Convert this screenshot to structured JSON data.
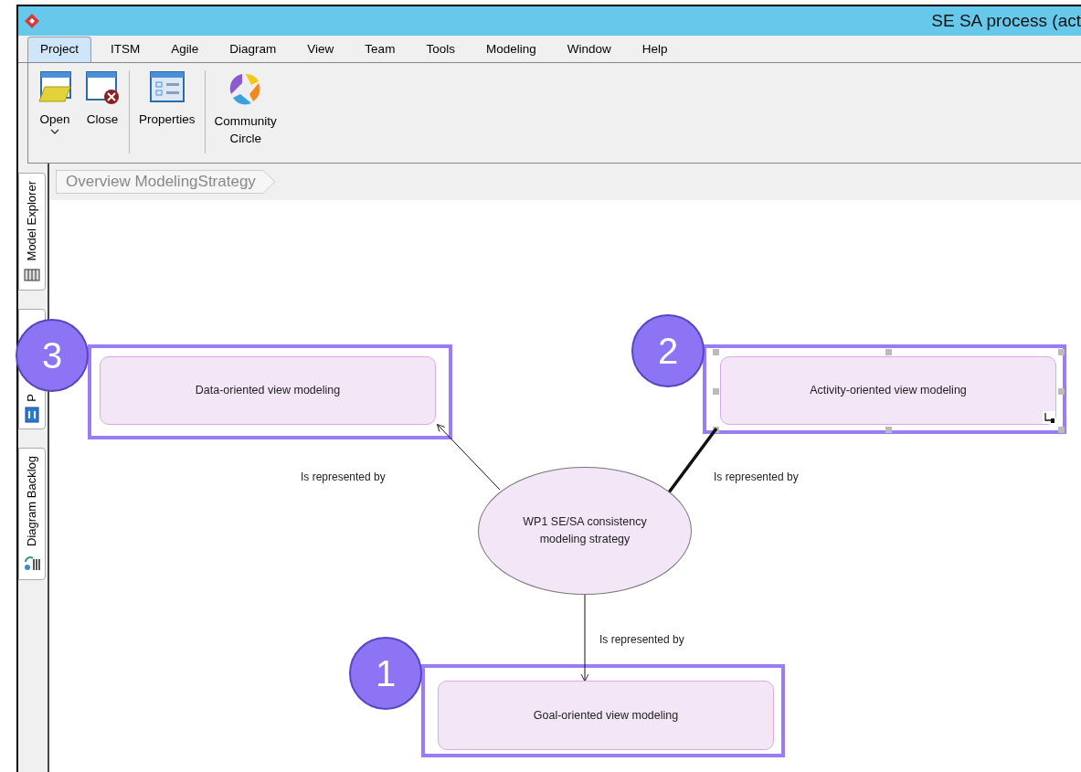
{
  "window": {
    "title": "SE SA process (act"
  },
  "menu_tabs": [
    {
      "label": "Project",
      "selected": true
    },
    {
      "label": "ITSM",
      "selected": false
    },
    {
      "label": "Agile",
      "selected": false
    },
    {
      "label": "Diagram",
      "selected": false
    },
    {
      "label": "View",
      "selected": false
    },
    {
      "label": "Team",
      "selected": false
    },
    {
      "label": "Tools",
      "selected": false
    },
    {
      "label": "Modeling",
      "selected": false
    },
    {
      "label": "Window",
      "selected": false
    },
    {
      "label": "Help",
      "selected": false
    }
  ],
  "ribbon": {
    "groups": [
      {
        "buttons": [
          {
            "label": "Open",
            "kind": "open",
            "dropdown": true
          },
          {
            "label": "Close",
            "kind": "close",
            "dropdown": false
          }
        ]
      },
      {
        "buttons": [
          {
            "label": "Properties",
            "kind": "properties",
            "dropdown": false
          }
        ]
      },
      {
        "buttons": [
          {
            "label": "Community\nCircle",
            "kind": "community",
            "dropdown": false
          }
        ]
      }
    ]
  },
  "side_tabs": [
    {
      "label": "Model Explorer",
      "kind": "explorer"
    },
    {
      "label": "P",
      "kind": "property"
    },
    {
      "label": "Diagram Backlog",
      "kind": "backlog"
    }
  ],
  "breadcrumb": "Overview ModelingStrategy",
  "diagram": {
    "nodes": [
      {
        "label": "Data-oriented view modeling",
        "kind": "rect",
        "selected": false,
        "callout": "3"
      },
      {
        "label": "Activity-oriented view modeling",
        "kind": "rect",
        "selected": true,
        "callout": "2"
      },
      {
        "label": "WP1 SE/SA consistency modeling strategy",
        "kind": "ellipse",
        "selected": false
      },
      {
        "label": "Goal-oriented view modeling",
        "kind": "rect",
        "selected": false,
        "callout": "1"
      }
    ],
    "edges": [
      {
        "label": "Is represented by",
        "selected": false
      },
      {
        "label": "Is represented by",
        "selected": true
      },
      {
        "label": "Is represented by",
        "selected": false
      }
    ]
  }
}
